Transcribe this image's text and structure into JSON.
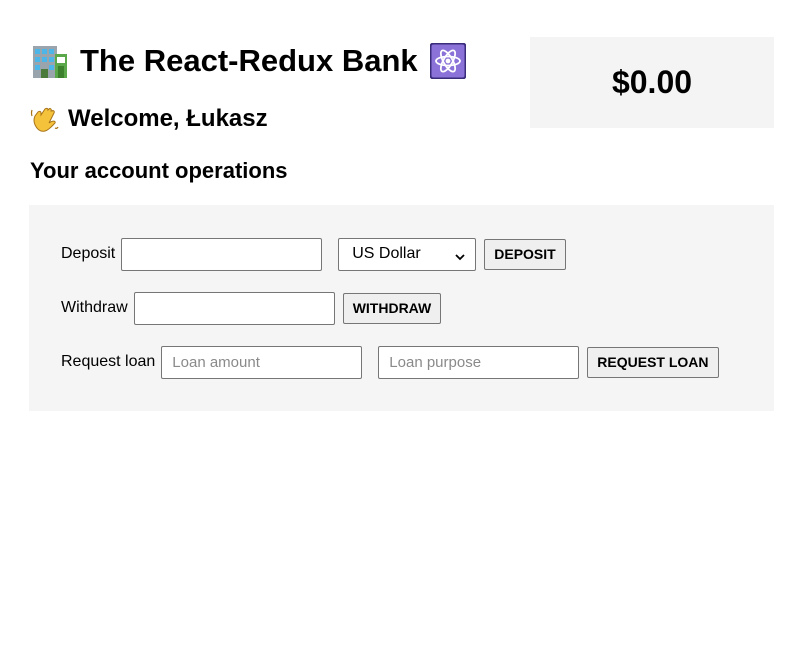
{
  "header": {
    "title": "The React-Redux Bank",
    "title_icon_left": "bank-building-icon",
    "title_icon_right": "atom-icon"
  },
  "balance": {
    "amount": "$0.00"
  },
  "welcome": {
    "text": "Welcome, Łukasz",
    "icon": "waving-hand-icon"
  },
  "operations": {
    "heading": "Your account operations",
    "deposit": {
      "label": "Deposit",
      "amount_value": "",
      "currency_selected": "US Dollar",
      "button_label": "DEPOSIT"
    },
    "withdraw": {
      "label": "Withdraw",
      "amount_value": "",
      "button_label": "WITHDRAW"
    },
    "loan": {
      "label": "Request loan",
      "amount_placeholder": "Loan amount",
      "purpose_placeholder": "Loan purpose",
      "button_label": "REQUEST LOAN"
    }
  },
  "colors": {
    "panel_bg": "#f5f5f5",
    "balance_bg": "#f4f4f4",
    "atom_bg": "#8a72d8",
    "button_bg": "#efefef"
  }
}
